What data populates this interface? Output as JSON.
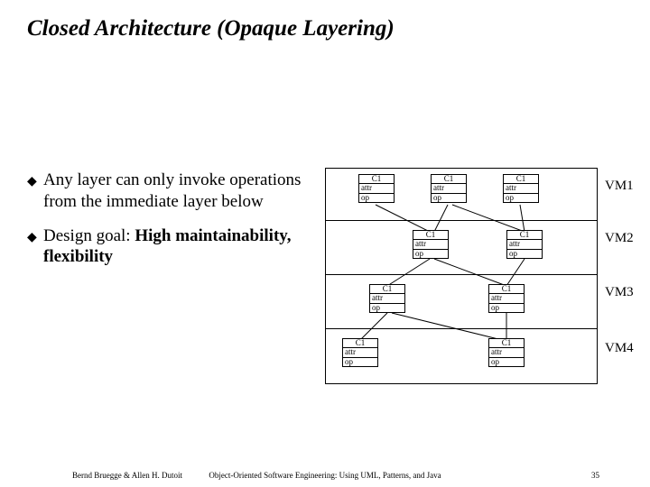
{
  "title": "Closed Architecture (Opaque Layering)",
  "bullets": {
    "b0": "Any layer can only invoke operations from the immediate layer below",
    "b1_lead": "Design goal: ",
    "b1_emph": "High maintainability, flexibility",
    "marker": "◆"
  },
  "class": {
    "name": "C1",
    "attr": "attr",
    "op": "op"
  },
  "labels": {
    "vm1": "VM1",
    "vm2": "VM2",
    "vm3": "VM3",
    "vm4": "VM4"
  },
  "footer": {
    "left": "Bernd Bruegge & Allen H. Dutoit",
    "mid": "Object-Oriented Software Engineering: Using UML, Patterns, and Java",
    "right": "35"
  }
}
